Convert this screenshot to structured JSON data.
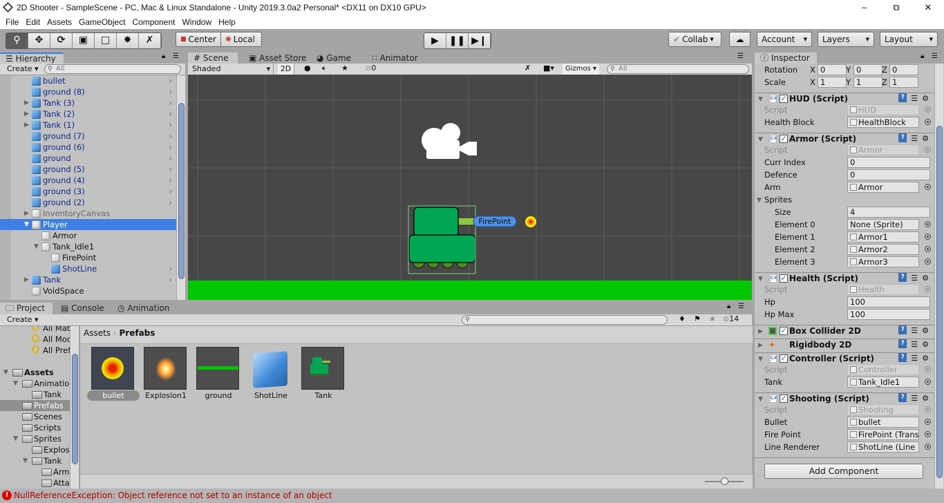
{
  "window": {
    "title": "2D Shooter - SampleScene - PC, Mac & Linux Standalone - Unity 2019.3.0a2 Personal* <DX11 on DX10 GPU>"
  },
  "menu": [
    "File",
    "Edit",
    "Assets",
    "GameObject",
    "Component",
    "Window",
    "Help"
  ],
  "toolbar": {
    "tools": [
      "hand-icon",
      "move-icon",
      "rotate-icon",
      "scale-icon",
      "rect-icon",
      "transform-icon",
      "custom-tool-icon"
    ],
    "pivot": "Center",
    "space": "Local",
    "collab": "Collab",
    "account": "Account",
    "layers": "Layers",
    "layout": "Layout"
  },
  "hierarchy": {
    "tab": "Hierarchy",
    "create": "Create",
    "search_placeholder": "All",
    "items": [
      {
        "label": "bullet",
        "level": 0,
        "prefab": true,
        "arrow": ""
      },
      {
        "label": "ground (8)",
        "level": 0,
        "prefab": true,
        "arrow": ""
      },
      {
        "label": "Tank (3)",
        "level": 0,
        "prefab": true,
        "arrow": "collapsed"
      },
      {
        "label": "Tank (2)",
        "level": 0,
        "prefab": true,
        "arrow": "collapsed"
      },
      {
        "label": "Tank (1)",
        "level": 0,
        "prefab": true,
        "arrow": "collapsed"
      },
      {
        "label": "ground (7)",
        "level": 0,
        "prefab": true,
        "arrow": ""
      },
      {
        "label": "ground (6)",
        "level": 0,
        "prefab": true,
        "arrow": ""
      },
      {
        "label": "ground",
        "level": 0,
        "prefab": true,
        "arrow": ""
      },
      {
        "label": "ground (5)",
        "level": 0,
        "prefab": true,
        "arrow": ""
      },
      {
        "label": "ground (4)",
        "level": 0,
        "prefab": true,
        "arrow": ""
      },
      {
        "label": "ground (3)",
        "level": 0,
        "prefab": true,
        "arrow": ""
      },
      {
        "label": "ground (2)",
        "level": 0,
        "prefab": true,
        "arrow": ""
      },
      {
        "label": "InventoryCanvas",
        "level": 0,
        "prefab": false,
        "arrow": "collapsed",
        "inactive": true
      },
      {
        "label": "Player",
        "level": 0,
        "prefab": false,
        "arrow": "expanded",
        "selected": true
      },
      {
        "label": "Armor",
        "level": 1,
        "prefab": false,
        "arrow": ""
      },
      {
        "label": "Tank_Idle1",
        "level": 1,
        "prefab": false,
        "arrow": "expanded"
      },
      {
        "label": "FirePoint",
        "level": 2,
        "prefab": false,
        "arrow": ""
      },
      {
        "label": "ShotLine",
        "level": 2,
        "prefab": true,
        "arrow": ""
      },
      {
        "label": "Tank",
        "level": 0,
        "prefab": true,
        "arrow": "collapsed"
      },
      {
        "label": "VoidSpace",
        "level": 0,
        "prefab": false,
        "arrow": ""
      }
    ]
  },
  "scene": {
    "tabs": [
      "Scene",
      "Asset Store",
      "Game",
      "Animator"
    ],
    "shading": "Shaded",
    "mode_2d": "2D",
    "hidden_count": "0",
    "gizmos": "Gizmos",
    "search_placeholder": "All",
    "firepoint_label": "FirePoint",
    "colors": {
      "background": "#474747",
      "ground": "#00c800",
      "tank": "#00a651"
    }
  },
  "inspector": {
    "tab": "Inspector",
    "transform": [
      {
        "label": "Rotation",
        "x": "0",
        "y": "0",
        "z": "0"
      },
      {
        "label": "Scale",
        "x": "1",
        "y": "1",
        "z": "1"
      }
    ],
    "components": [
      {
        "name": "HUD (Script)",
        "icon": "csharp",
        "enabled": true,
        "expanded": true,
        "fields": [
          {
            "label": "Script",
            "value": "HUD",
            "type": "object",
            "disabled": true
          },
          {
            "label": "Health Block",
            "value": "HealthBlock",
            "type": "object"
          }
        ]
      },
      {
        "name": "Armor (Script)",
        "icon": "csharp",
        "enabled": true,
        "expanded": true,
        "fields": [
          {
            "label": "Script",
            "value": "Armor",
            "type": "object",
            "disabled": true
          },
          {
            "label": "Curr Index",
            "value": "0",
            "type": "value"
          },
          {
            "label": "Defence",
            "value": "0",
            "type": "value"
          },
          {
            "label": "Arm",
            "value": "Armor",
            "type": "object"
          },
          {
            "label": "Sprites",
            "type": "foldout"
          },
          {
            "label": "Size",
            "value": "4",
            "type": "value",
            "indent": true
          },
          {
            "label": "Element 0",
            "value": "None (Sprite)",
            "type": "object",
            "indent": true,
            "noicon": true
          },
          {
            "label": "Element 1",
            "value": "Armor1",
            "type": "object",
            "indent": true
          },
          {
            "label": "Element 2",
            "value": "Armor2",
            "type": "object",
            "indent": true
          },
          {
            "label": "Element 3",
            "value": "Armor3",
            "type": "object",
            "indent": true
          }
        ]
      },
      {
        "name": "Health (Script)",
        "icon": "csharp",
        "enabled": true,
        "expanded": true,
        "fields": [
          {
            "label": "Script",
            "value": "Health",
            "type": "object",
            "disabled": true
          },
          {
            "label": "Hp",
            "value": "100",
            "type": "value"
          },
          {
            "label": "Hp Max",
            "value": "100",
            "type": "value"
          }
        ]
      },
      {
        "name": "Box Collider 2D",
        "icon": "box-collider",
        "enabled": true,
        "expanded": false,
        "fields": []
      },
      {
        "name": "Rigidbody 2D",
        "icon": "rigidbody",
        "enabled": null,
        "expanded": false,
        "fields": []
      },
      {
        "name": "Controller (Script)",
        "icon": "csharp",
        "enabled": true,
        "expanded": true,
        "fields": [
          {
            "label": "Script",
            "value": "Controller",
            "type": "object",
            "disabled": true
          },
          {
            "label": "Tank",
            "value": "Tank_Idle1",
            "type": "object"
          }
        ]
      },
      {
        "name": "Shooting (Script)",
        "icon": "csharp",
        "enabled": true,
        "expanded": true,
        "fields": [
          {
            "label": "Script",
            "value": "Shooting",
            "type": "object",
            "disabled": true
          },
          {
            "label": "Bullet",
            "value": "bullet",
            "type": "object"
          },
          {
            "label": "Fire Point",
            "value": "FirePoint (Trans",
            "type": "object"
          },
          {
            "label": "Line Renderer",
            "value": "ShotLine (Line I",
            "type": "object"
          }
        ]
      }
    ],
    "add_component": "Add Component"
  },
  "project": {
    "tabs": [
      "Project",
      "Console",
      "Animation"
    ],
    "create": "Create",
    "hidden_count": "14",
    "tree": [
      {
        "label": "All Materi",
        "level": 1,
        "kind": "search"
      },
      {
        "label": "All Model",
        "level": 1,
        "kind": "search"
      },
      {
        "label": "All Prefab",
        "level": 1,
        "kind": "search"
      },
      {
        "label": "",
        "level": 0,
        "kind": "spacer"
      },
      {
        "label": "Assets",
        "level": 0,
        "kind": "folder",
        "arrow": "expanded",
        "bold": true
      },
      {
        "label": "Animation",
        "level": 1,
        "kind": "folder",
        "arrow": "expanded"
      },
      {
        "label": "Tank",
        "level": 2,
        "kind": "folder"
      },
      {
        "label": "Prefabs",
        "level": 1,
        "kind": "folder",
        "selected": true
      },
      {
        "label": "Scenes",
        "level": 1,
        "kind": "folder"
      },
      {
        "label": "Scripts",
        "level": 1,
        "kind": "folder"
      },
      {
        "label": "Sprites",
        "level": 1,
        "kind": "folder",
        "arrow": "expanded"
      },
      {
        "label": "Explos",
        "level": 2,
        "kind": "folder"
      },
      {
        "label": "Tank",
        "level": 2,
        "kind": "folder",
        "arrow": "expanded"
      },
      {
        "label": "Arm",
        "level": 3,
        "kind": "folder"
      },
      {
        "label": "Atta",
        "level": 3,
        "kind": "folder"
      }
    ],
    "breadcrumb": [
      "Assets",
      "Prefabs"
    ],
    "assets": [
      {
        "label": "bullet",
        "thumb": "bullet",
        "selected": true
      },
      {
        "label": "Explosion1",
        "thumb": "explosion"
      },
      {
        "label": "ground",
        "thumb": "ground"
      },
      {
        "label": "ShotLine",
        "thumb": "cube"
      },
      {
        "label": "Tank",
        "thumb": "tank"
      }
    ]
  },
  "status": {
    "message": "NullReferenceException: Object reference not set to an instance of an object",
    "color": "#b00000"
  }
}
